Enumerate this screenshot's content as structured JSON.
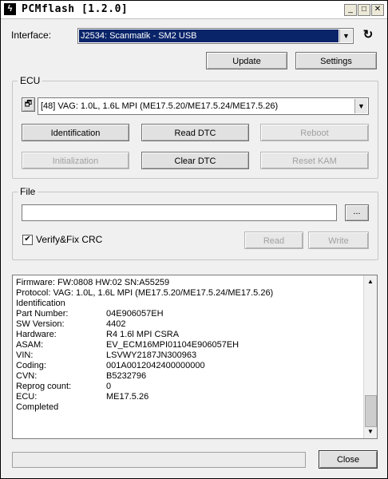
{
  "window": {
    "title": "PCMflash [1.2.0]",
    "min": "_",
    "max": "□",
    "close": "✕"
  },
  "interface": {
    "label": "Interface:",
    "selected": "J2534: Scanmatik - SM2 USB",
    "refresh_icon": "refresh-icon",
    "update_label": "Update",
    "settings_label": "Settings"
  },
  "ecu": {
    "group_label": "ECU",
    "selected": "[48] VAG: 1.0L, 1.6L MPI (ME17.5.20/ME17.5.24/ME17.5.26)",
    "buttons": {
      "identification": "Identification",
      "read_dtc": "Read DTC",
      "reboot": "Reboot",
      "initialization": "Initialization",
      "clear_dtc": "Clear DTC",
      "reset_kam": "Reset KAM"
    }
  },
  "file": {
    "group_label": "File",
    "path_value": "",
    "browse_label": "...",
    "verify_checked": true,
    "verify_label": "Verify&Fix CRC",
    "read_label": "Read",
    "write_label": "Write"
  },
  "log": {
    "lines": [
      "Firmware: FW:0808 HW:02 SN:A55259",
      "Protocol: VAG: 1.0L, 1.6L MPI (ME17.5.20/ME17.5.24/ME17.5.26)",
      "Identification"
    ],
    "rows": [
      {
        "key": "Part Number:",
        "value": "04E906057EH"
      },
      {
        "key": "SW Version:",
        "value": "4402"
      },
      {
        "key": "Hardware:",
        "value": "R4 1.6l MPI CSRA"
      },
      {
        "key": "ASAM:",
        "value": "EV_ECM16MPI01104E906057EH"
      },
      {
        "key": "VIN:",
        "value": "LSVWY2187JN300963"
      },
      {
        "key": "Coding:",
        "value": "001A0012042400000000"
      },
      {
        "key": "CVN:",
        "value": "B5232796"
      },
      {
        "key": "Reprog count:",
        "value": "0"
      },
      {
        "key": "ECU:",
        "value": "ME17.5.26"
      }
    ],
    "footer": "Completed"
  },
  "status": {
    "text": ""
  },
  "close_label": "Close"
}
